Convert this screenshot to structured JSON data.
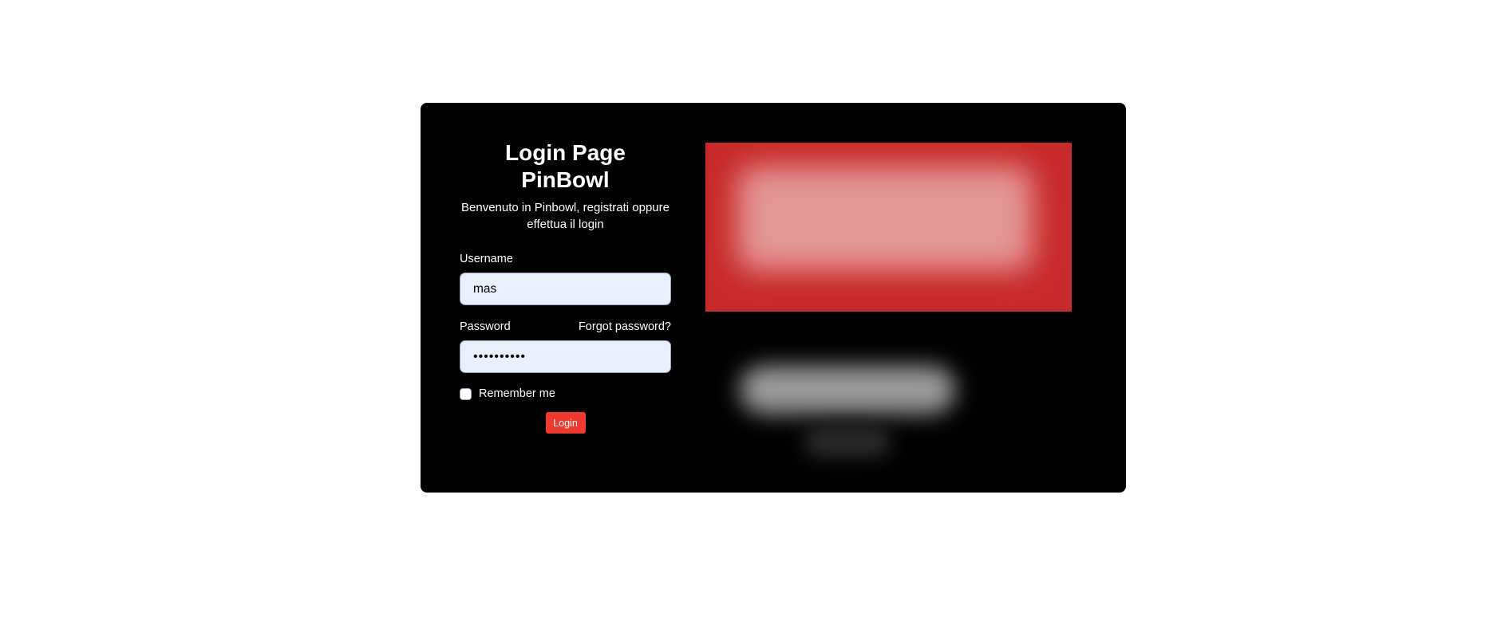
{
  "login": {
    "title": "Login Page PinBowl",
    "subtitle": "Benvenuto in Pinbowl, registrati oppure effettua il login",
    "username_label": "Username",
    "username_value": "mas",
    "password_label": "Password",
    "password_value": "••••••••••",
    "forgot_link": "Forgot password?",
    "remember_label": "Remember me",
    "remember_checked": false,
    "submit_label": "Login"
  },
  "colors": {
    "card_background": "#000000",
    "input_background": "#e8f0fe",
    "button_background": "#f03a2f",
    "banner_background": "#c8292a"
  },
  "images": {
    "banner": "blurred-brand-banner",
    "logo": "blurred-logo"
  }
}
